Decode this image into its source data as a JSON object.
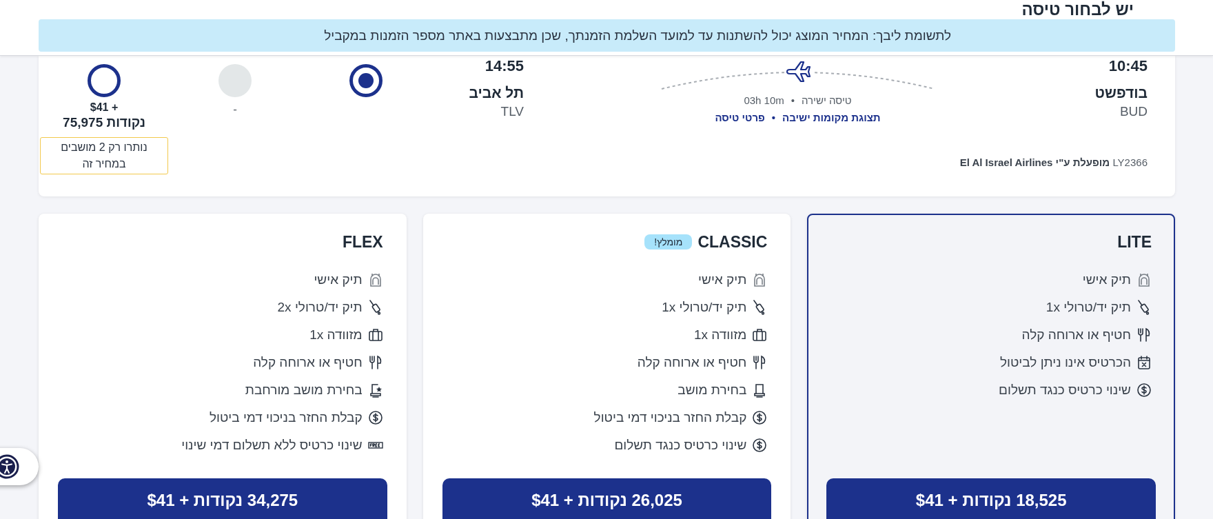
{
  "page_title": "יש לבחור טיסה",
  "notice": "לתשומת ליבך:  המחיר המוצג יכול להשתנות עד למועד השלמת הזמנתך, שכן מתבצעות באתר מספר הזמנות במקביל",
  "flight": {
    "departure": {
      "time": "10:45",
      "city": "בודפשט",
      "code": "BUD"
    },
    "arrival": {
      "time": "14:55",
      "city": "תל אביב",
      "code": "TLV"
    },
    "flight_type": "טיסה ישירה",
    "separator": "•",
    "duration": "03h 10m",
    "links": [
      {
        "label": "תצוגת מקומות ישיבה"
      },
      {
        "label": "פרטי טיסה"
      }
    ],
    "operator": "LY2366 **מופעלת ע\"י El Al Israel Airlines**",
    "fares": [
      {
        "selected": true,
        "available": true
      },
      {
        "selected": false,
        "available": false,
        "price": "-"
      },
      {
        "selected": false,
        "available": true,
        "price": "+ $41",
        "points": "נקודות 75,975",
        "warning": "נותרו רק 2 מושבים במחיר זה"
      }
    ]
  },
  "fare_cards": [
    {
      "name": "LITE",
      "selected": true,
      "features": [
        {
          "kind": "backpack",
          "text": "תיק אישי"
        },
        {
          "kind": "trolley",
          "text": "תיק יד/טרולי 1x"
        },
        {
          "kind": "meal",
          "text": "חטיף או ארוחה קלה"
        },
        {
          "kind": "no-cancel",
          "text": "הכרטיס אינו ניתן לביטול"
        },
        {
          "kind": "dollar",
          "text": "שינוי כרטיס כנגד תשלום"
        }
      ],
      "button": "18,525 נקודות + $41"
    },
    {
      "name": "CLASSIC",
      "badge": "מומלץ!",
      "selected": false,
      "features": [
        {
          "kind": "backpack",
          "text": "תיק אישי"
        },
        {
          "kind": "trolley",
          "text": "תיק יד/טרולי 1x"
        },
        {
          "kind": "suitcase",
          "text": "מזוודה 1x"
        },
        {
          "kind": "meal",
          "text": "חטיף או ארוחה קלה"
        },
        {
          "kind": "seat",
          "text": "בחירת מושב"
        },
        {
          "kind": "dollar",
          "text": "קבלת החזר בניכוי דמי ביטול"
        },
        {
          "kind": "dollar",
          "text": "שינוי כרטיס כנגד תשלום"
        }
      ],
      "button": "26,025 נקודות + $41"
    },
    {
      "name": "FLEX",
      "selected": false,
      "features": [
        {
          "kind": "backpack",
          "text": "תיק אישי"
        },
        {
          "kind": "trolley",
          "text": "תיק יד/טרולי 2x"
        },
        {
          "kind": "suitcase",
          "text": "מזוודה 1x"
        },
        {
          "kind": "meal",
          "text": "חטיף או ארוחה קלה"
        },
        {
          "kind": "seat-star",
          "text": "בחירת מושב מורחבת"
        },
        {
          "kind": "dollar",
          "text": "קבלת החזר בניכוי דמי ביטול"
        },
        {
          "kind": "free",
          "text": "שינוי כרטיס ללא תשלום דמי שינוי"
        }
      ],
      "button": "34,275 נקודות + $41"
    }
  ]
}
